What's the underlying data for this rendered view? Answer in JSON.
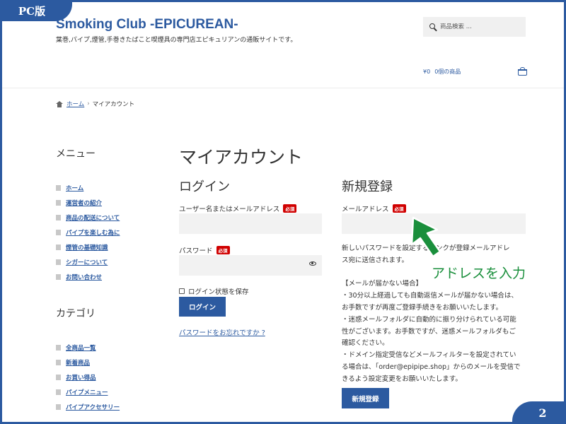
{
  "badge": {
    "version": "PC版",
    "page_number": "2"
  },
  "site": {
    "title": "Smoking Club -EPICUREAN-",
    "description": "葉巻,パイプ,煙管,手巻きたばこと喫煙具の専門店エピキュリアンの通販サイトです。"
  },
  "search": {
    "placeholder": "商品検索 ..."
  },
  "cart": {
    "amount": "¥0",
    "count": "0個の商品"
  },
  "breadcrumb": {
    "home": "ホーム",
    "separator": "›",
    "current": "マイアカウント"
  },
  "sidebar": {
    "menu_heading": "メニュー",
    "menu_items": [
      "ホーム",
      "運営者の紹介",
      "商品の配送について",
      "パイプを楽しむ為に",
      "煙管の基礎知識",
      "シガーについて",
      "お問い合わせ"
    ],
    "category_heading": "カテゴリ",
    "category_items": [
      "全商品一覧",
      "新着商品",
      "お買い得品",
      "パイプメニュー",
      "パイプアクセサリー"
    ]
  },
  "main": {
    "page_title": "マイアカウント",
    "login": {
      "heading": "ログイン",
      "username_label": "ユーザー名またはメールアドレス",
      "required": "必須",
      "password_label": "パスワード",
      "remember_label": "ログイン状態を保存",
      "login_button": "ログイン",
      "forgot_link": "パスワードをお忘れですか ?"
    },
    "register": {
      "heading": "新規登録",
      "email_label": "メールアドレス",
      "required": "必須",
      "info_lines": [
        "新しいパスワードを設定するリンクが登録メールアドレ",
        "ス宛に送信されます。",
        "",
        "【メールが届かない場合】",
        "・30分以上経過しても自動返信メールが届かない場合は、",
        "お手数ですが再度ご登録手続きをお願いいたします。",
        "・迷惑メールフォルダに自動的に振り分けられている可能",
        "性がございます。お手数ですが、迷惑メールフォルダもご",
        "確認ください。",
        "・ドメイン指定受信などメールフィルターを設定されてい",
        "る場合は、「order@epipipe.shop」からのメールを受信で",
        "きるよう設定変更をお願いいたします。"
      ],
      "register_button": "新規登録"
    }
  },
  "annotation": {
    "text": "アドレスを入力",
    "color": "#1a8f3c"
  },
  "colors": {
    "brand": "#2c5aa0",
    "required_badge": "#d00000",
    "input_bg": "#f2f2f2"
  }
}
